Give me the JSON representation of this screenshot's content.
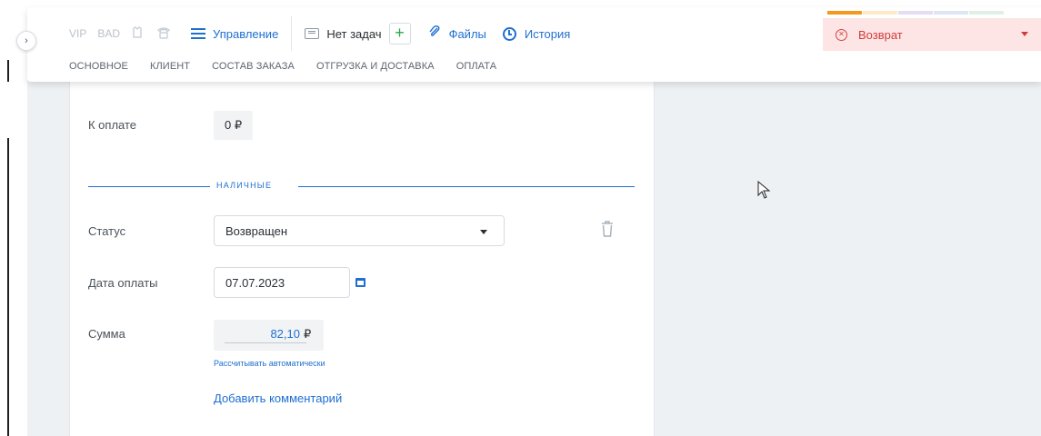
{
  "toolbar": {
    "flags": [
      "VIP",
      "BAD"
    ],
    "menu_label": "Управление",
    "tasks_label": "Нет задач",
    "files_label": "Файлы",
    "history_label": "История",
    "icons": [
      "chevron-right-icon",
      "shirt-icon",
      "phone-icon",
      "hamburger-icon",
      "list-icon",
      "plus-icon",
      "paperclip-icon",
      "clock-icon"
    ]
  },
  "tabs": [
    "ОСНОВНОЕ",
    "КЛИЕНТ",
    "СОСТАВ ЗАКАЗА",
    "ОТГРУЗКА И ДОСТАВКА",
    "ОПЛАТА"
  ],
  "order_status": {
    "label": "Возврат",
    "colors": {
      "background": "#fde5e5",
      "text": "#d13b3b"
    },
    "strip_colors": [
      "#f39a1e",
      "#fde9c7",
      "#e6dcf3",
      "#dde6f5",
      "#dff1e4"
    ]
  },
  "payment": {
    "to_pay_label": "К оплате",
    "to_pay_value": "0 ₽",
    "section_title": "НАЛИЧНЫЕ",
    "status_label": "Статус",
    "status_value": "Возвращен",
    "date_label": "Дата оплаты",
    "date_value": "07.07.2023",
    "sum_label": "Сумма",
    "sum_value": "82,10",
    "sum_currency": "₽",
    "auto_calc_link": "Рассчитывать автоматически",
    "add_comment_link": "Добавить комментарий"
  },
  "colors": {
    "accent": "#1f6fd1",
    "add_green": "#2aa84a"
  }
}
